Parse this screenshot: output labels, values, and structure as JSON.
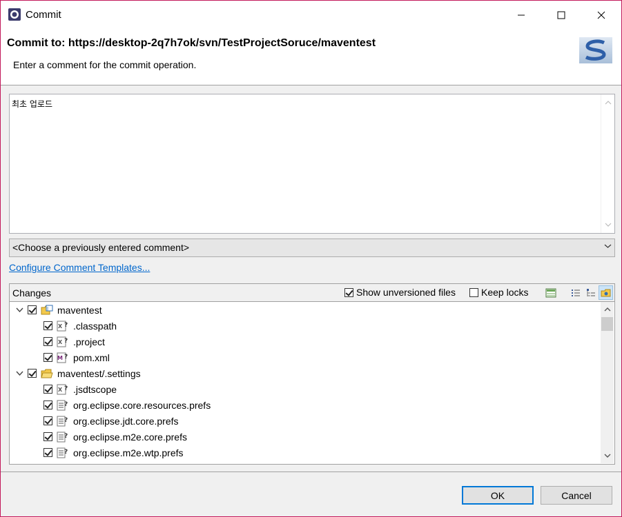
{
  "window": {
    "title": "Commit",
    "accent": "#c2185b"
  },
  "header": {
    "commit_to": "Commit to: https://desktop-2q7h7ok/svn/TestProjectSoruce/maventest",
    "subtitle": "Enter a comment for the commit operation."
  },
  "comment": {
    "value": "최초 업로드"
  },
  "history": {
    "selected": "<Choose a previously entered comment>"
  },
  "templates_link": "Configure Comment Templates...",
  "changes": {
    "title": "Changes",
    "show_unversioned_label": "Show unversioned files",
    "show_unversioned_checked": true,
    "keep_locks_label": "Keep locks",
    "keep_locks_checked": false,
    "tree": [
      {
        "label": "maventest",
        "type": "project-folder",
        "level": 0,
        "expanded": true,
        "checked": true
      },
      {
        "label": ".classpath",
        "type": "xml-file",
        "level": 1,
        "checked": true
      },
      {
        "label": ".project",
        "type": "xml-file",
        "level": 1,
        "checked": true
      },
      {
        "label": "pom.xml",
        "type": "maven-file",
        "level": 1,
        "checked": true
      },
      {
        "label": "maventest/.settings",
        "type": "folder",
        "level": 0,
        "expanded": true,
        "checked": true
      },
      {
        "label": ".jsdtscope",
        "type": "xml-file",
        "level": 1,
        "checked": true
      },
      {
        "label": "org.eclipse.core.resources.prefs",
        "type": "text-file",
        "level": 1,
        "checked": true
      },
      {
        "label": "org.eclipse.jdt.core.prefs",
        "type": "text-file",
        "level": 1,
        "checked": true
      },
      {
        "label": "org.eclipse.m2e.core.prefs",
        "type": "text-file",
        "level": 1,
        "checked": true
      },
      {
        "label": "org.eclipse.m2e.wtp.prefs",
        "type": "text-file",
        "level": 1,
        "checked": true
      }
    ]
  },
  "buttons": {
    "ok": "OK",
    "cancel": "Cancel"
  }
}
